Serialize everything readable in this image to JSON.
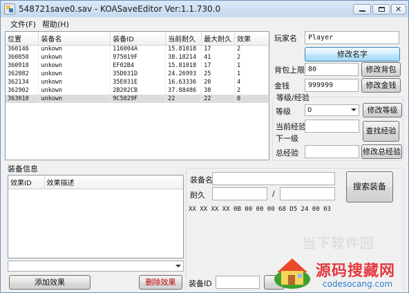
{
  "window": {
    "title": "548721save0.sav - KOASaveEditor Ver:1.1.730.0"
  },
  "menu": [
    "文件(F)",
    "帮助(H)"
  ],
  "equipment_table": {
    "headers": [
      "位置",
      "装备名",
      "装备ID",
      "当前耐久",
      "最大耐久",
      "效果"
    ],
    "rows": [
      [
        "360146",
        "unkown",
        "116004A",
        "15.81018",
        "17",
        "2"
      ],
      [
        "360858",
        "unkown",
        "975019F",
        "38.18214",
        "41",
        "2"
      ],
      [
        "360918",
        "unkown",
        "EF02B4",
        "15.81018",
        "17",
        "1"
      ],
      [
        "362082",
        "unkown",
        "35D031D",
        "24.26993",
        "25",
        "1"
      ],
      [
        "362134",
        "unkown",
        "35E031E",
        "16.63336",
        "20",
        "4"
      ],
      [
        "362902",
        "unkown",
        "2B202CB",
        "37.88486",
        "38",
        "2"
      ],
      [
        "363010",
        "unkown",
        "9C5029F",
        "22",
        "22",
        "0"
      ]
    ]
  },
  "player": {
    "name_label": "玩家名",
    "name_value": "Player",
    "rename_button": "修改名字",
    "bag_label": "背包上限",
    "bag_value": "80",
    "bag_button": "修改背包",
    "money_label": "金钱",
    "money_value": "999999",
    "money_button": "修改金钱"
  },
  "level_group": {
    "title": "等级/经验",
    "level_label": "等级",
    "level_value": "0",
    "level_button": "修改等级",
    "current_exp_label": "当前经验",
    "next_level_label": "下一级",
    "find_exp_button": "查找经验",
    "total_exp_label": "总经验",
    "total_exp_button": "修改总经验"
  },
  "equip_info": {
    "title": "装备信息",
    "headers": [
      "效果ID",
      "效果描述"
    ],
    "add_button": "添加效果",
    "delete_button": "删除效果"
  },
  "equip_search": {
    "name_label": "装备名",
    "durability_label": "耐久",
    "separator": "/",
    "search_button": "搜索装备",
    "hex": "XX XX XX XX 0B 00 00 00 68 D5 24 00 03",
    "id_label": "装备ID"
  },
  "watermark": {
    "faint_text": "当下软件园",
    "title": "源码搜藏网",
    "domain": "codesocang.com"
  },
  "colors": {
    "title_bar": "#c5d9ef",
    "delete_text": "#c00000",
    "watermark_red": "#e3393e",
    "watermark_blue": "#2b7fd0"
  }
}
